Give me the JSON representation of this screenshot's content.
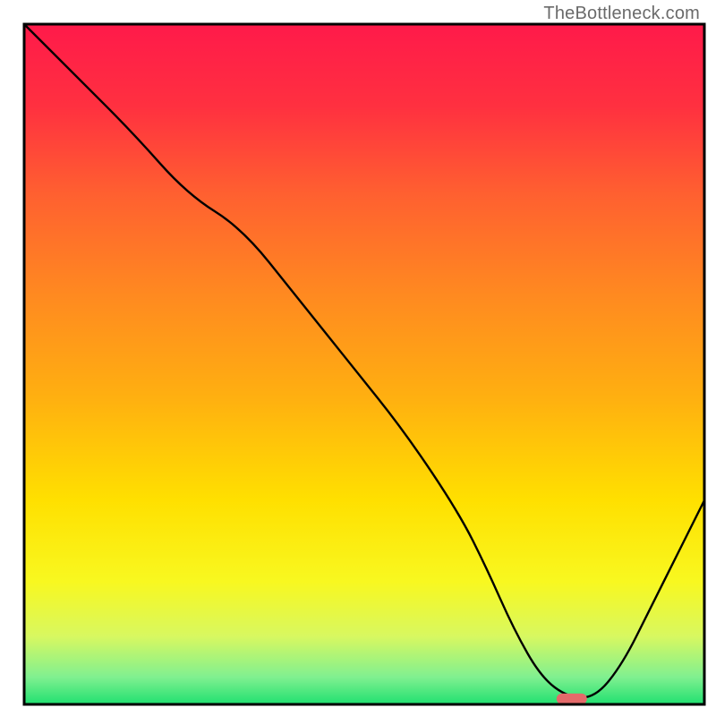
{
  "watermark": "TheBottleneck.com",
  "chart_data": {
    "type": "line",
    "title": "",
    "xlabel": "",
    "ylabel": "",
    "xlim": [
      0,
      100
    ],
    "ylim": [
      0,
      100
    ],
    "series": [
      {
        "name": "curve",
        "x": [
          0,
          8,
          16,
          24,
          32,
          40,
          48,
          56,
          64,
          68,
          72,
          76,
          80,
          84,
          88,
          92,
          96,
          100
        ],
        "values": [
          100,
          92,
          84,
          75,
          70,
          60,
          50,
          40,
          28,
          20,
          11,
          4,
          1,
          1,
          6,
          14,
          22,
          30
        ]
      }
    ],
    "marker": {
      "x": 80.5,
      "y": 0.8,
      "color": "#e46a6a"
    },
    "gradient_stops": [
      {
        "offset": 0.0,
        "color": "#ff1a4a"
      },
      {
        "offset": 0.12,
        "color": "#ff3040"
      },
      {
        "offset": 0.25,
        "color": "#ff6030"
      },
      {
        "offset": 0.4,
        "color": "#ff8a20"
      },
      {
        "offset": 0.55,
        "color": "#ffb010"
      },
      {
        "offset": 0.7,
        "color": "#ffe000"
      },
      {
        "offset": 0.82,
        "color": "#f8f820"
      },
      {
        "offset": 0.9,
        "color": "#d8f860"
      },
      {
        "offset": 0.96,
        "color": "#80f090"
      },
      {
        "offset": 1.0,
        "color": "#20e070"
      }
    ]
  }
}
